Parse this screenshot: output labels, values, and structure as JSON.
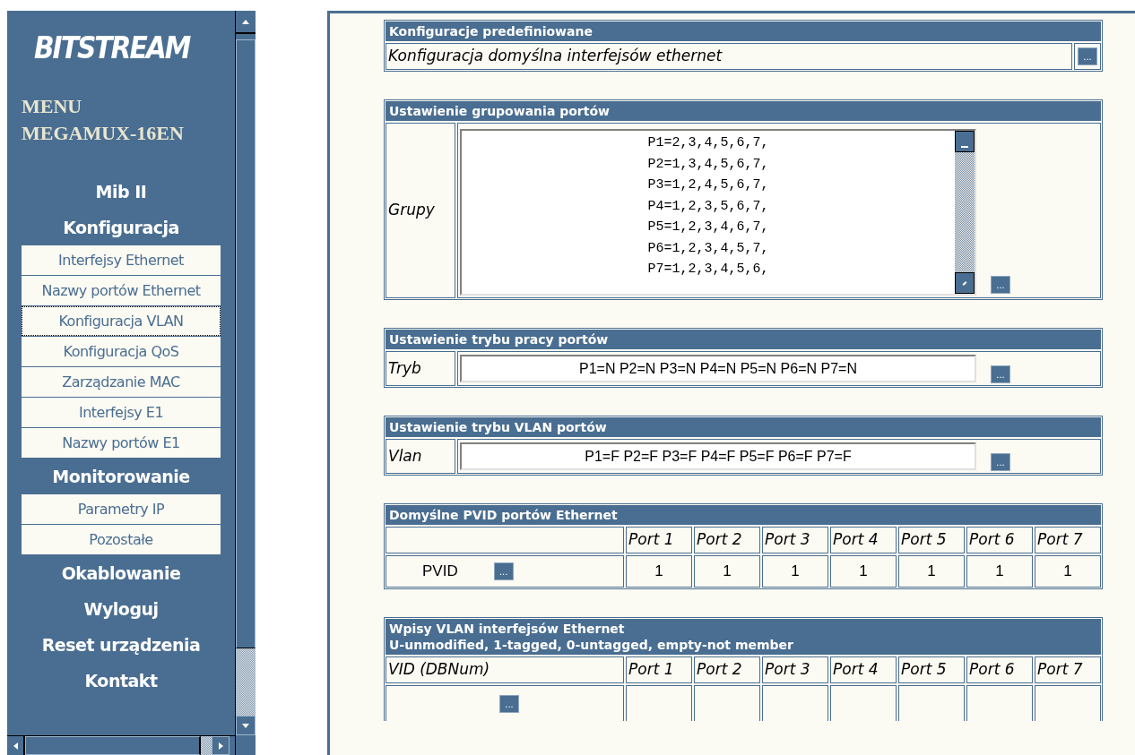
{
  "sidebar": {
    "logo": "BITSTREAM",
    "title_lines": [
      "MENU",
      "MEGAMUX-16EN"
    ],
    "items": [
      {
        "kind": "heading",
        "label": "Mib II"
      },
      {
        "kind": "heading",
        "label": "Konfiguracja"
      },
      {
        "kind": "link",
        "label": "Interfejsy Ethernet",
        "selected": false
      },
      {
        "kind": "link",
        "label": "Nazwy portów Ethernet",
        "selected": false
      },
      {
        "kind": "link",
        "label": "Konfiguracja VLAN",
        "selected": true
      },
      {
        "kind": "link",
        "label": "Konfiguracja QoS",
        "selected": false
      },
      {
        "kind": "link",
        "label": "Zarządzanie MAC",
        "selected": false
      },
      {
        "kind": "link",
        "label": "Interfejsy E1",
        "selected": false
      },
      {
        "kind": "link",
        "label": "Nazwy portów E1",
        "selected": false
      },
      {
        "kind": "heading",
        "label": "Monitorowanie"
      },
      {
        "kind": "link",
        "label": "Parametry IP",
        "selected": false
      },
      {
        "kind": "link",
        "label": "Pozostałe",
        "selected": false
      },
      {
        "kind": "heading",
        "label": "Okablowanie"
      },
      {
        "kind": "heading",
        "label": "Wyloguj"
      },
      {
        "kind": "heading",
        "label": "Reset urządzenia"
      },
      {
        "kind": "heading",
        "label": "Kontakt"
      }
    ]
  },
  "predefined": {
    "title": "Konfiguracje predefiniowane",
    "text": "Konfiguracja domyślna interfejsów ethernet",
    "button": "..."
  },
  "grouping": {
    "title": "Ustawienie grupowania portów",
    "label": "Grupy",
    "lines": [
      "P1=2,3,4,5,6,7,",
      "P2=1,3,4,5,6,7,",
      "P3=1,2,4,5,6,7,",
      "P4=1,2,3,5,6,7,",
      "P5=1,2,3,4,6,7,",
      "P6=1,2,3,4,5,7,",
      "P7=1,2,3,4,5,6,"
    ],
    "button": "..."
  },
  "settings": [
    {
      "title": "Ustawienie trybu pracy portów",
      "label": "Tryb",
      "value": "P1=N P2=N P3=N P4=N P5=N P6=N P7=N",
      "button": "..."
    },
    {
      "title": "Ustawienie trybu VLAN portów",
      "label": "Vlan",
      "value": "P1=F P2=F P3=F P4=F P5=F P6=F P7=F",
      "button": "..."
    }
  ],
  "pvid": {
    "title": "Domyślne PVID portów Ethernet",
    "columns": [
      "Port 1",
      "Port 2",
      "Port 3",
      "Port 4",
      "Port 5",
      "Port 6",
      "Port 7"
    ],
    "row_label": "PVID",
    "button": "...",
    "values": [
      "1",
      "1",
      "1",
      "1",
      "1",
      "1",
      "1"
    ]
  },
  "vlan_entries": {
    "title": "Wpisy VLAN interfejsów Ethernet",
    "subtitle": "U-unmodified, 1-tagged, 0-untagged, empty-not member",
    "first_column": "VID (DBNum)",
    "columns": [
      "Port 1",
      "Port 2",
      "Port 3",
      "Port 4",
      "Port 5",
      "Port 6",
      "Port 7"
    ],
    "button": "..."
  }
}
